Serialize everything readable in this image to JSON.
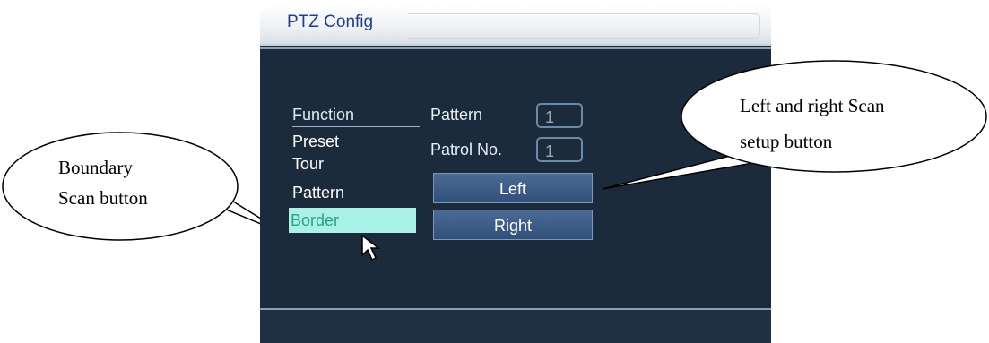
{
  "window": {
    "title": "PTZ Config"
  },
  "menu": {
    "header": "Function",
    "items": [
      {
        "label": "Preset"
      },
      {
        "label": "Tour"
      },
      {
        "label": "Pattern"
      },
      {
        "label": "Border",
        "selected": true
      }
    ]
  },
  "fields": {
    "pattern": {
      "label": "Pattern",
      "value": "1"
    },
    "patrol": {
      "label": "Patrol No.",
      "value": "1"
    }
  },
  "buttons": {
    "left": "Left",
    "right": "Right"
  },
  "callouts": {
    "boundary": [
      "Boundary",
      "Scan button"
    ],
    "leftright": [
      "Left and right Scan",
      "setup button"
    ]
  },
  "colors": {
    "panel_bg": "#1c2b3b",
    "selected_bg": "#aaf2e8",
    "selected_text": "#2aa085",
    "button_bg": "#3a5a85",
    "title_text": "#1c3f93"
  }
}
